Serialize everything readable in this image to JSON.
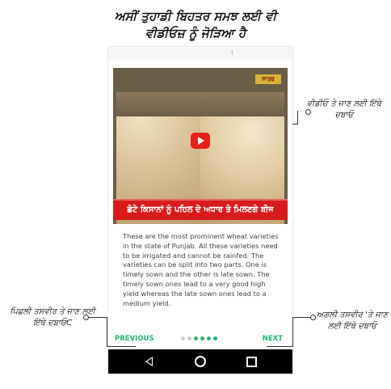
{
  "title": {
    "line1": "ਅਸੀਂ ਤੁਹਾਡੀ ਬਿਹਤਰ ਸਮਝ ਲਈ ਵੀ",
    "line2": "ਵੀਡੀਓਜ਼ ਨੂੰ ਜੋੜਿਆ ਹੈ"
  },
  "video": {
    "banner": "ਛੋਟੇ ਕਿਸਾਨਾਂ ਨੂੰ ਪਹਿਲ ਦੇ ਅਧਾਰ ਤੇ ਮਿਲਣਗੇ ਬੀਜ",
    "logo": "ਸਾਰਥ"
  },
  "description": "These are the most prominent wheat varieties in the state of Punjab. All these varieties need to be irrigated and cannot be rainfed. The varieties can be split into two parts. One is timely sown and the other is late sown. The timely sown ones lead to a very good high yield whereas the late sown ones lead to a medium yield.",
  "nav": {
    "previous": "PREVIOUS",
    "next": "NEXT"
  },
  "annotations": {
    "video": "ਵੀਡੀਓ ਤੇ ਜਾਣ ਲਈ ਇੱਥੇ ਦਬਾਓ",
    "previous": "ਪਿਛਲੀ ਤਸਵੀਰ ਤੇ ਜਾਣ ਲਈ ਇੱਥੇ ਦਬਾਓC",
    "next": "ਅਗਲੀ ਤਸਵੀਰ 'ਤੇ ਜਾਣ ਲਈ ਇੱਥੇ ਦਬਾਓ"
  },
  "colors": {
    "accent": "#22b573",
    "banner": "#d91b1b",
    "play": "#e62117"
  }
}
